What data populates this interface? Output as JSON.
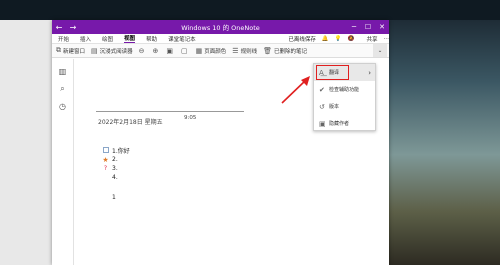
{
  "window": {
    "title": "Windows 10 的 OneNote",
    "back": "←",
    "forward": "→"
  },
  "menu": {
    "tabs": [
      "开始",
      "插入",
      "绘图",
      "视图",
      "帮助",
      "课堂笔记本"
    ],
    "active": 3,
    "status": "已离线保存",
    "share": "共享"
  },
  "toolbar": {
    "new_window": "新建窗口",
    "immersive_reader": "沉浸式阅读器",
    "page_color": "页面颜色",
    "rule_lines": "规则线",
    "deleted_notes": "已删除的笔记",
    "more": "⌄"
  },
  "page": {
    "date": "2022年2月18日 星期五",
    "time": "9:05",
    "items": [
      {
        "marker": "",
        "text": "1.你好"
      },
      {
        "marker": "★",
        "text": "2."
      },
      {
        "marker": "?",
        "text": "3."
      },
      {
        "marker": "",
        "text": "4."
      }
    ],
    "extra_line": "1"
  },
  "dropdown": {
    "items": [
      {
        "icon": "translate-icon",
        "label": "翻译"
      },
      {
        "icon": "accessibility-icon",
        "label": "检查辅助功能"
      },
      {
        "icon": "history-icon",
        "label": "版本"
      },
      {
        "icon": "author-icon",
        "label": "隐藏作者"
      }
    ]
  }
}
